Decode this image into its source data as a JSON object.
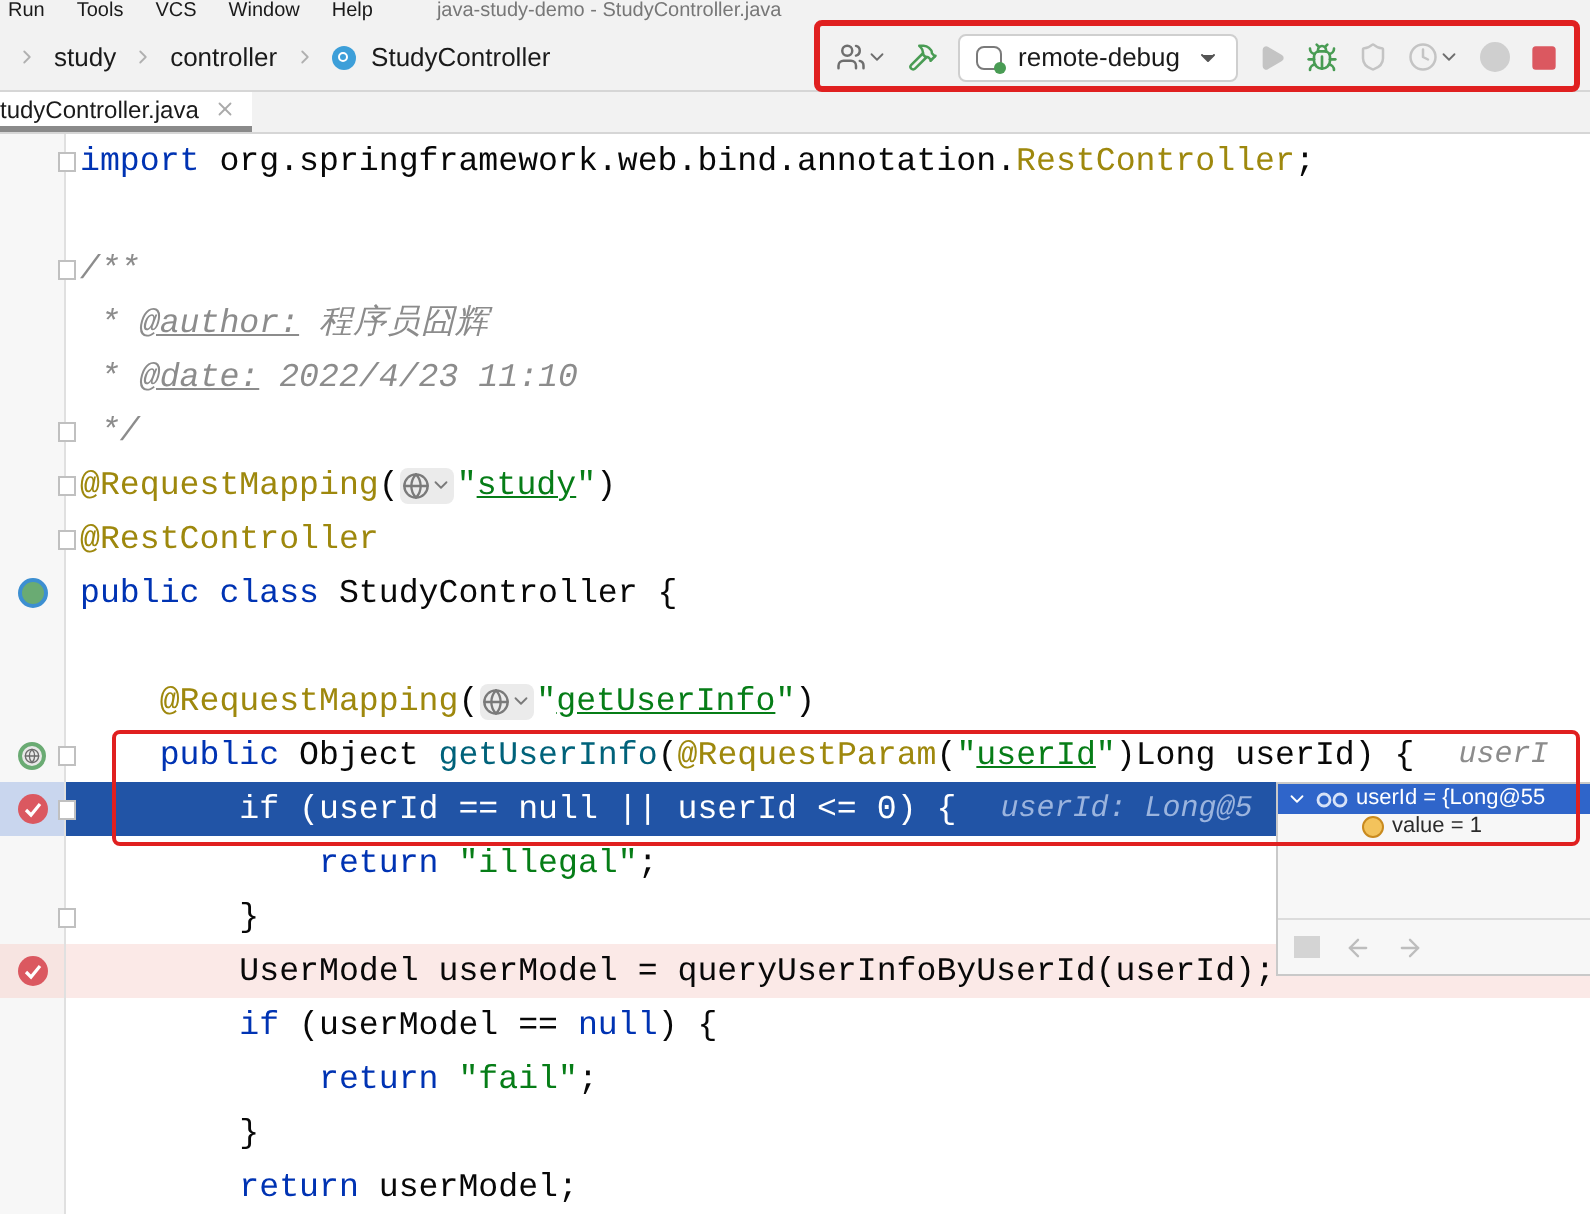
{
  "menu": [
    "Run",
    "Tools",
    "VCS",
    "Window",
    "Help"
  ],
  "window": {
    "title": "java-study-demo - StudyController.java"
  },
  "breadcrumb": [
    {
      "label": "study",
      "kind": "folder"
    },
    {
      "label": "controller",
      "kind": "folder"
    },
    {
      "label": "StudyController",
      "kind": "class"
    }
  ],
  "toolbar": {
    "buttons": [
      {
        "kind": "user",
        "disabled": false
      },
      {
        "kind": "build",
        "disabled": false
      }
    ],
    "run_config": {
      "label": "remote-debug"
    },
    "actions": [
      {
        "kind": "run",
        "disabled": true
      },
      {
        "kind": "debug",
        "disabled": false
      },
      {
        "kind": "coverage",
        "disabled": true
      },
      {
        "kind": "profile",
        "disabled": true
      },
      {
        "kind": "pause",
        "disabled": true
      },
      {
        "kind": "stop",
        "disabled": false
      }
    ]
  },
  "tabs": [
    {
      "label": "tudyController.java",
      "selected": true
    }
  ],
  "lines": [
    {
      "kind": "plain",
      "fold": true,
      "current": false,
      "tokens": [
        {
          "kind": "kw",
          "t": "import"
        },
        {
          "kind": "plain",
          "t": " org.springframework.web.bind.annotation."
        },
        {
          "kind": "ann",
          "t": "RestController"
        },
        {
          "kind": "plain",
          "t": ";"
        }
      ]
    },
    {
      "kind": "plain",
      "fold": false,
      "current": false
    },
    {
      "kind": "plain",
      "fold": true,
      "current": false,
      "tokens": [
        {
          "kind": "cmt",
          "t": "/**"
        }
      ]
    },
    {
      "kind": "plain",
      "fold": false,
      "current": false,
      "tokens": [
        {
          "kind": "cmt",
          "t": " * "
        },
        {
          "kind": "doctag",
          "t": "@author:"
        },
        {
          "kind": "cmt",
          "t": " 程序员囧辉"
        }
      ]
    },
    {
      "kind": "plain",
      "fold": false,
      "current": false,
      "tokens": [
        {
          "kind": "cmt",
          "t": " * "
        },
        {
          "kind": "doctag",
          "t": "@date:"
        },
        {
          "kind": "cmt",
          "t": " 2022/4/23 11:10"
        }
      ]
    },
    {
      "kind": "plain",
      "fold": true,
      "current": false,
      "tokens": [
        {
          "kind": "cmt",
          "t": " */"
        }
      ]
    },
    {
      "kind": "plain",
      "fold": true,
      "current": false,
      "tokens": [
        {
          "kind": "ann",
          "t": "@RequestMapping"
        },
        {
          "kind": "plain",
          "t": "("
        },
        {
          "kind": "inlay"
        },
        {
          "kind": "str",
          "t": "\""
        },
        {
          "kind": "strlink",
          "t": "study"
        },
        {
          "kind": "str",
          "t": "\""
        },
        {
          "kind": "plain",
          "t": ")"
        }
      ]
    },
    {
      "kind": "plain",
      "fold": true,
      "current": false,
      "tokens": [
        {
          "kind": "ann",
          "t": "@RestController"
        }
      ]
    },
    {
      "kind": "bean",
      "fold": false,
      "current": false,
      "tokens": [
        {
          "kind": "kw",
          "t": "public class "
        },
        {
          "kind": "plain",
          "t": "StudyController {"
        }
      ]
    },
    {
      "kind": "plain",
      "fold": false,
      "current": false
    },
    {
      "kind": "plain",
      "fold": false,
      "current": false,
      "tokens": [
        {
          "kind": "ann",
          "t": "    @RequestMapping"
        },
        {
          "kind": "plain",
          "t": "("
        },
        {
          "kind": "inlay"
        },
        {
          "kind": "str",
          "t": "\""
        },
        {
          "kind": "strlink",
          "t": "getUserInfo"
        },
        {
          "kind": "str",
          "t": "\""
        },
        {
          "kind": "plain",
          "t": ")"
        }
      ]
    },
    {
      "kind": "endpoint",
      "fold": true,
      "current": false,
      "hint": "userI",
      "tokens": [
        {
          "kind": "kw",
          "t": "    public "
        },
        {
          "kind": "plain",
          "t": "Object "
        },
        {
          "kind": "method",
          "t": "getUserInfo"
        },
        {
          "kind": "plain",
          "t": "("
        },
        {
          "kind": "ann",
          "t": "@RequestParam"
        },
        {
          "kind": "plain",
          "t": "("
        },
        {
          "kind": "str",
          "t": "\""
        },
        {
          "kind": "strlink",
          "t": "userId"
        },
        {
          "kind": "str",
          "t": "\""
        },
        {
          "kind": "plain",
          "t": ")Long userId) {"
        }
      ]
    },
    {
      "kind": "breakpoint",
      "fold": true,
      "current": true,
      "hint": "userId: Long@5",
      "tokens": [
        {
          "kind": "kw",
          "t": "        if"
        },
        {
          "kind": "plain",
          "t": " (userId == "
        },
        {
          "kind": "kw",
          "t": "null"
        },
        {
          "kind": "plain",
          "t": " || userId <= "
        },
        {
          "kind": "num",
          "t": "0"
        },
        {
          "kind": "plain",
          "t": ") {"
        }
      ]
    },
    {
      "kind": "plain",
      "fold": false,
      "current": false,
      "tokens": [
        {
          "kind": "kw",
          "t": "            return "
        },
        {
          "kind": "str",
          "t": "\"illegal\""
        },
        {
          "kind": "plain",
          "t": ";"
        }
      ]
    },
    {
      "kind": "plain",
      "fold": true,
      "current": false,
      "tokens": [
        {
          "kind": "plain",
          "t": "        }"
        }
      ]
    },
    {
      "kind": "breakpoint",
      "fold": false,
      "current": false,
      "tokens": [
        {
          "kind": "plain",
          "t": "        UserModel userModel = queryUserInfoByUserId(userId);"
        }
      ]
    },
    {
      "kind": "plain",
      "fold": false,
      "current": false,
      "tokens": [
        {
          "kind": "kw",
          "t": "        if"
        },
        {
          "kind": "plain",
          "t": " (userModel == "
        },
        {
          "kind": "kw",
          "t": "null"
        },
        {
          "kind": "plain",
          "t": ") {"
        }
      ]
    },
    {
      "kind": "plain",
      "fold": false,
      "current": false,
      "tokens": [
        {
          "kind": "kw",
          "t": "            return "
        },
        {
          "kind": "str",
          "t": "\"fail\""
        },
        {
          "kind": "plain",
          "t": ";"
        }
      ]
    },
    {
      "kind": "plain",
      "fold": false,
      "current": false,
      "tokens": [
        {
          "kind": "plain",
          "t": "        }"
        }
      ]
    },
    {
      "kind": "plain",
      "fold": false,
      "current": false,
      "tokens": [
        {
          "kind": "kw",
          "t": "        return "
        },
        {
          "kind": "plain",
          "t": "userModel;"
        }
      ]
    }
  ],
  "debug_popup": {
    "tree": [
      {
        "label": "userId = {Long@55",
        "expanded": true,
        "selected": true,
        "children": [
          {
            "label": "value = 1",
            "selected": false
          }
        ]
      }
    ]
  }
}
